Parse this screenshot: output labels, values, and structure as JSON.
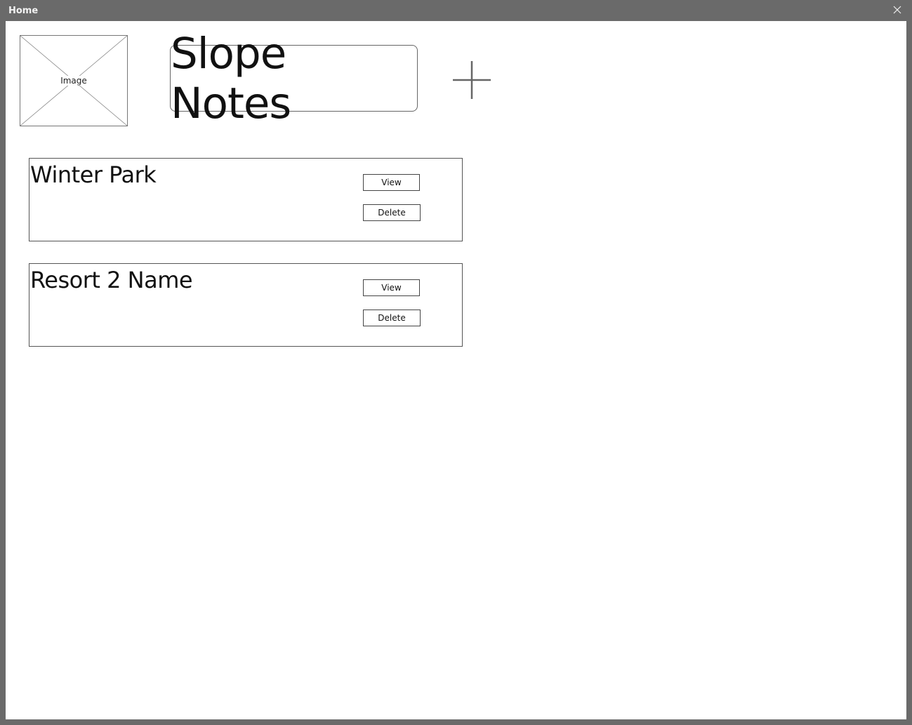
{
  "window": {
    "title": "Home"
  },
  "header": {
    "image_label": "Image",
    "app_title": "Slope Notes"
  },
  "resorts": [
    {
      "name": "Winter Park",
      "view_label": "View",
      "delete_label": "Delete"
    },
    {
      "name": "Resort 2 Name",
      "view_label": "View",
      "delete_label": "Delete"
    }
  ],
  "icons": {
    "close": "close-icon",
    "add": "plus-icon",
    "image": "image-placeholder-icon"
  },
  "colors": {
    "titlebar": "#6a6a6a",
    "title_text": "#f2f2f2",
    "plus": "#666666"
  }
}
